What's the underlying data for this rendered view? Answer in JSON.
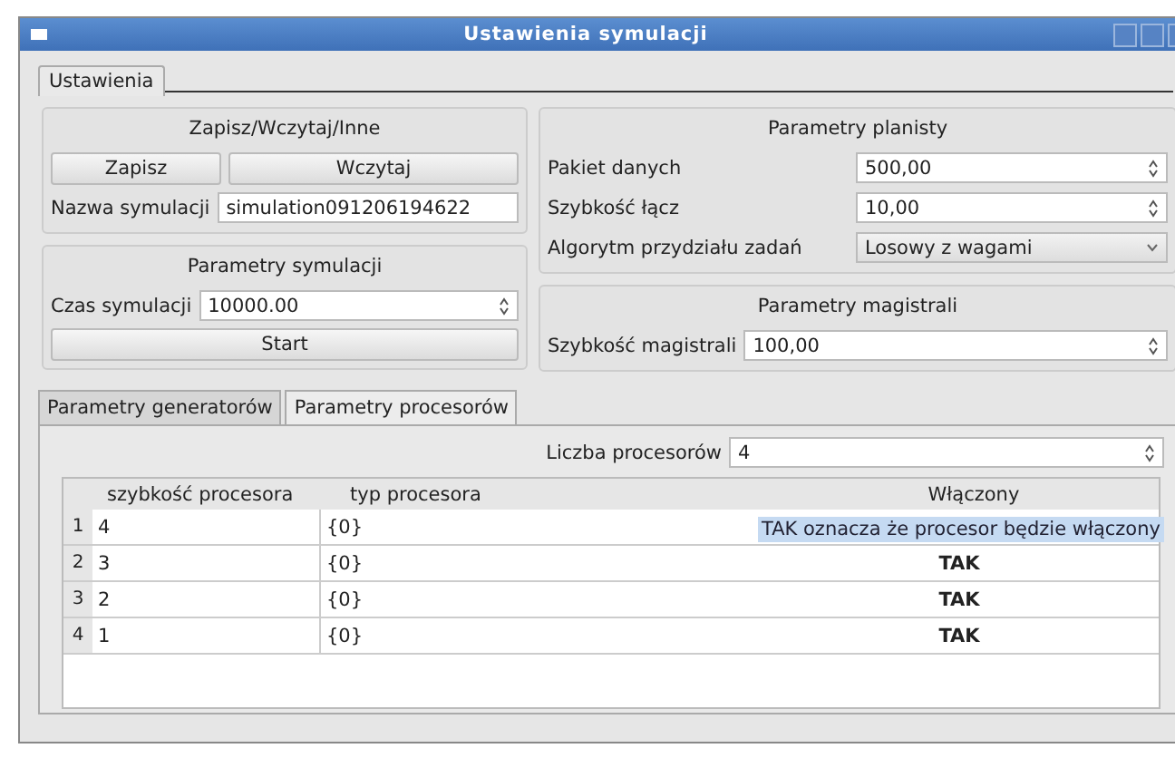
{
  "window": {
    "title": "Ustawienia symulacji"
  },
  "tabs": [
    {
      "label": "Ustawienia",
      "selected": true
    }
  ],
  "save_load": {
    "title": "Zapisz/Wczytaj/Inne",
    "buttons": [
      "Zapisz",
      "Wczytaj"
    ],
    "name_label": "Nazwa symulacji",
    "name_value": "simulation091206194622"
  },
  "simulation": {
    "title": "Parametry symulacji",
    "time_label": "Czas symulacji",
    "time_value": "10000.00",
    "start_button": "Start"
  },
  "scheduler": {
    "title": "Parametry planisty",
    "fields": [
      {
        "kind": "spin",
        "label": "Pakiet danych",
        "value": "500,00"
      },
      {
        "kind": "spin",
        "label": "Szybkość łącz",
        "value": "10,00"
      },
      {
        "kind": "combo",
        "label": "Algorytm przydziału zadań",
        "value": "Losowy z wagami"
      }
    ]
  },
  "bus": {
    "title": "Parametry magistrali",
    "label": "Szybkość magistrali",
    "value": "100,00"
  },
  "inner_tabs": [
    {
      "label": "Parametry generatorów",
      "selected": false
    },
    {
      "label": "Parametry procesorów",
      "selected": true
    }
  ],
  "processors": {
    "count_label": "Liczba procesorów",
    "count_value": "4",
    "table": {
      "columns": [
        "szybkość procesora",
        "typ procesora",
        "Włączony"
      ],
      "rows": [
        {
          "index": "1",
          "cells": [
            "4",
            "{0}"
          ]
        },
        {
          "index": "2",
          "cells": [
            "3",
            "{0}",
            "TAK"
          ]
        },
        {
          "index": "3",
          "cells": [
            "2",
            "{0}",
            "TAK"
          ]
        },
        {
          "index": "4",
          "cells": [
            "1",
            "{0}",
            "TAK"
          ]
        }
      ]
    },
    "tooltip": "TAK oznacza że procesor będzie włączony"
  }
}
